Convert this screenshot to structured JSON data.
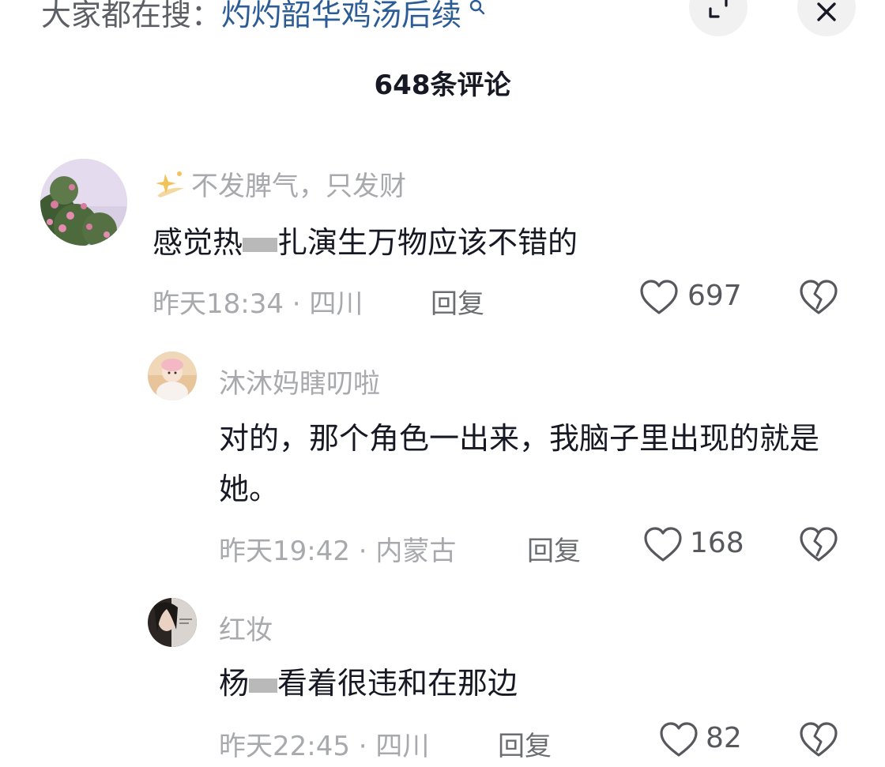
{
  "header": {
    "search_prefix": "大家都在搜：",
    "search_link": "灼灼韶华鸡汤后续",
    "comment_count": "648条评论"
  },
  "comments": [
    {
      "username": "不发脾气，只发财",
      "content_a": "感觉热",
      "content_b": "扎演生万物应该不错的",
      "time": "昨天18:34",
      "sep": "·",
      "location": "四川",
      "reply": "回复",
      "likes": "697"
    },
    {
      "username": "沐沐妈瞎叨啦",
      "content": "对的，那个角色一出来，我脑子里出现的就是她。",
      "time": "昨天19:42",
      "sep": "·",
      "location": "内蒙古",
      "reply": "回复",
      "likes": "168"
    },
    {
      "username": "红妆",
      "content_a": "杨",
      "content_b": "看着很违和在那边",
      "time": "昨天22:45",
      "sep": "·",
      "location": "四川",
      "reply": "回复",
      "likes": "82"
    }
  ],
  "colors": {
    "link": "#2b5c95",
    "muted": "#a8a9ad",
    "text": "#161823",
    "button_bg": "#f1f1f2"
  },
  "icons": [
    "search-icon",
    "expand-icon",
    "close-icon",
    "sparkle-icon",
    "heart-icon",
    "dislike-icon"
  ]
}
